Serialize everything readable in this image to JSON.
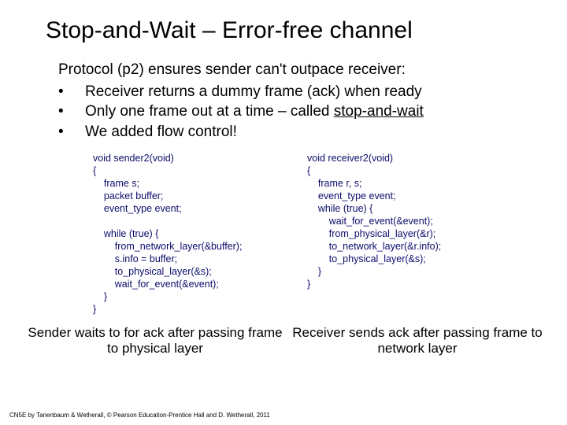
{
  "title": "Stop-and-Wait – Error-free channel",
  "intro": "Protocol (p2) ensures sender can't outpace receiver:",
  "bullets": {
    "b1": "Receiver returns a dummy frame (ack) when ready",
    "b2_pre": "Only one frame out at a time – called ",
    "b2_term": "stop-and-wait",
    "b3": "We added flow control!"
  },
  "code": {
    "sender": "void sender2(void)\n{\n    frame s;\n    packet buffer;\n    event_type event;\n\n    while (true) {\n        from_network_layer(&buffer);\n        s.info = buffer;\n        to_physical_layer(&s);\n        wait_for_event(&event);\n    }\n}",
    "receiver": "void receiver2(void)\n{\n    frame r, s;\n    event_type event;\n    while (true) {\n        wait_for_event(&event);\n        from_physical_layer(&r);\n        to_network_layer(&r.info);\n        to_physical_layer(&s);\n    }\n}"
  },
  "captions": {
    "sender": "Sender waits to for ack after passing frame to physical layer",
    "receiver": "Receiver sends ack after passing frame to network layer"
  },
  "footer": "CN5E by Tanenbaum & Wetherall, © Pearson Education-Prentice Hall and D. Wetherall, 2011",
  "dot": "•"
}
